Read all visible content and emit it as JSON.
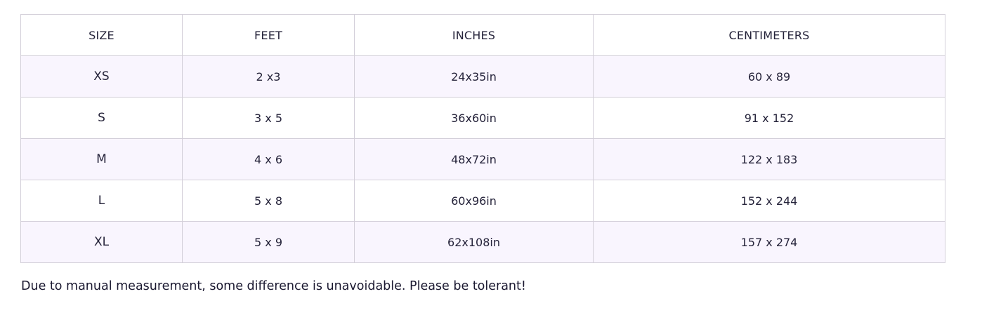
{
  "table": {
    "headers": [
      "SIZE",
      "FEET",
      "INCHES",
      "CENTIMETERS"
    ],
    "rows": [
      {
        "size": "XS",
        "feet": "2 x3",
        "inches": "24x35in",
        "cm": "60 x 89"
      },
      {
        "size": "S",
        "feet": "3 x 5",
        "inches": "36x60in",
        "cm": "91 x 152"
      },
      {
        "size": "M",
        "feet": "4 x 6",
        "inches": "48x72in",
        "cm": "122 x 183"
      },
      {
        "size": "L",
        "feet": "5 x 8",
        "inches": "60x96in",
        "cm": "152 x 244"
      },
      {
        "size": "XL",
        "feet": "5 x 9",
        "inches": "62x108in",
        "cm": "157 x 274"
      }
    ]
  },
  "note": "Due to manual measurement, some difference is unavoidable. Please be tolerant!",
  "colors": {
    "border": "#d3cfd9",
    "stripe": "#f9f5fe",
    "text": "#25233a"
  }
}
